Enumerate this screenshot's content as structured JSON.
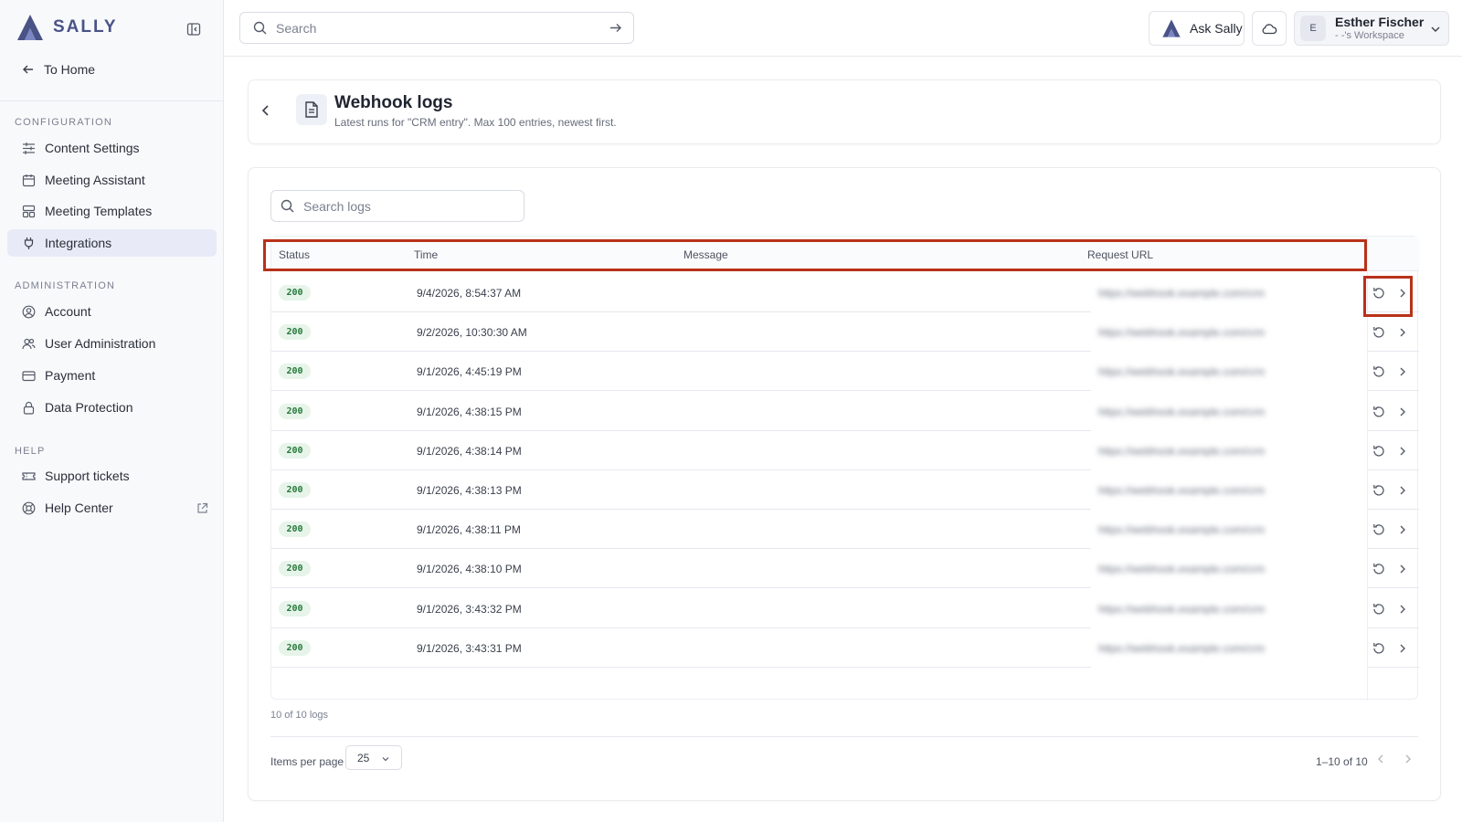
{
  "app": {
    "brand": "SALLY",
    "brand_color": "#4a5386",
    "accent_color": "#b8321a"
  },
  "sidebar": {
    "to_home": "To Home",
    "sections": {
      "configuration": "CONFIGURATION",
      "administration": "ADMINISTRATION",
      "help": "HELP"
    },
    "items": [
      {
        "label": "Content Settings",
        "icon": "sliders-icon"
      },
      {
        "label": "Meeting Assistant",
        "icon": "calendar-icon"
      },
      {
        "label": "Meeting Templates",
        "icon": "template-icon"
      },
      {
        "label": "Integrations",
        "icon": "plug-icon",
        "active": true
      },
      {
        "label": "Account",
        "icon": "user-circle-icon"
      },
      {
        "label": "User Administration",
        "icon": "users-icon"
      },
      {
        "label": "Payment",
        "icon": "credit-card-icon"
      },
      {
        "label": "Data Protection",
        "icon": "lock-icon"
      },
      {
        "label": "Support tickets",
        "icon": "ticket-icon"
      },
      {
        "label": "Help Center",
        "icon": "lifebuoy-icon"
      }
    ]
  },
  "topbar": {
    "search_placeholder": "Search",
    "ask_sally": "Ask Sally",
    "user": {
      "initial": "E",
      "name": "Esther Fischer",
      "workspace": "- -'s Workspace"
    }
  },
  "header": {
    "title": "Webhook logs",
    "subtitle": "Latest runs for \"CRM entry\". Max 100 entries, newest first."
  },
  "logs": {
    "search_placeholder": "Search logs",
    "columns": [
      "Status",
      "Time",
      "Message",
      "Request URL"
    ],
    "rows": [
      {
        "status": "200",
        "time": "9/4/2026, 8:54:37 AM",
        "message": "",
        "url": "https://webhook.example.com/crm"
      },
      {
        "status": "200",
        "time": "9/2/2026, 10:30:30 AM",
        "message": "",
        "url": "https://webhook.example.com/crm"
      },
      {
        "status": "200",
        "time": "9/1/2026, 4:45:19 PM",
        "message": "",
        "url": "https://webhook.example.com/crm"
      },
      {
        "status": "200",
        "time": "9/1/2026, 4:38:15 PM",
        "message": "",
        "url": "https://webhook.example.com/crm"
      },
      {
        "status": "200",
        "time": "9/1/2026, 4:38:14 PM",
        "message": "",
        "url": "https://webhook.example.com/crm"
      },
      {
        "status": "200",
        "time": "9/1/2026, 4:38:13 PM",
        "message": "",
        "url": "https://webhook.example.com/crm"
      },
      {
        "status": "200",
        "time": "9/1/2026, 4:38:11 PM",
        "message": "",
        "url": "https://webhook.example.com/crm"
      },
      {
        "status": "200",
        "time": "9/1/2026, 4:38:10 PM",
        "message": "",
        "url": "https://webhook.example.com/crm"
      },
      {
        "status": "200",
        "time": "9/1/2026, 3:43:32 PM",
        "message": "",
        "url": "https://webhook.example.com/crm"
      },
      {
        "status": "200",
        "time": "9/1/2026, 3:43:31 PM",
        "message": "",
        "url": "https://webhook.example.com/crm"
      }
    ],
    "count_text": "10 of 10 logs",
    "items_per_page_label": "Items per page",
    "items_per_page_value": "25",
    "range_text": "1–10 of 10"
  }
}
